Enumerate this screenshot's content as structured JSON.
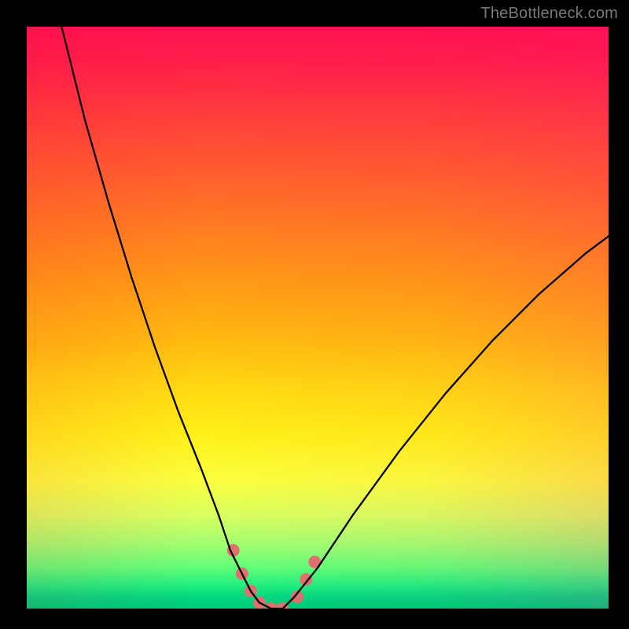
{
  "watermark": "TheBottleneck.com",
  "chart_data": {
    "type": "line",
    "title": "",
    "xlabel": "",
    "ylabel": "",
    "xlim": [
      0,
      100
    ],
    "ylim": [
      0,
      100
    ],
    "grid": false,
    "legend": false,
    "series": [
      {
        "name": "bottleneck-curve",
        "x": [
          6,
          10,
          14,
          18,
          22,
          26,
          30,
          33,
          35,
          37,
          38.5,
          40,
          42,
          44,
          46,
          50,
          56,
          64,
          72,
          80,
          88,
          96,
          100
        ],
        "values": [
          100,
          84,
          70,
          57,
          45,
          34,
          24,
          16,
          10,
          6,
          3,
          1,
          0,
          0,
          2,
          7,
          16,
          27,
          37,
          46,
          54,
          61,
          64
        ],
        "color": "#000000",
        "width": 2.3
      }
    ],
    "markers": [
      {
        "name": "fit-markers",
        "color": "#e07070",
        "radius_px": 8,
        "points": [
          {
            "x": 35.5,
            "y": 10
          },
          {
            "x": 37.0,
            "y": 6
          },
          {
            "x": 38.5,
            "y": 3
          },
          {
            "x": 40.0,
            "y": 1
          },
          {
            "x": 42.0,
            "y": 0
          },
          {
            "x": 44.0,
            "y": 0
          },
          {
            "x": 46.5,
            "y": 2
          },
          {
            "x": 48.0,
            "y": 5
          },
          {
            "x": 49.5,
            "y": 8
          }
        ]
      }
    ],
    "gradient_stops": [
      {
        "pos": 0,
        "color": "#ff1450"
      },
      {
        "pos": 24,
        "color": "#ff5a30"
      },
      {
        "pos": 54,
        "color": "#ffba10"
      },
      {
        "pos": 78,
        "color": "#faff3e"
      },
      {
        "pos": 93,
        "color": "#60ff78"
      },
      {
        "pos": 100,
        "color": "#00c878"
      }
    ]
  }
}
